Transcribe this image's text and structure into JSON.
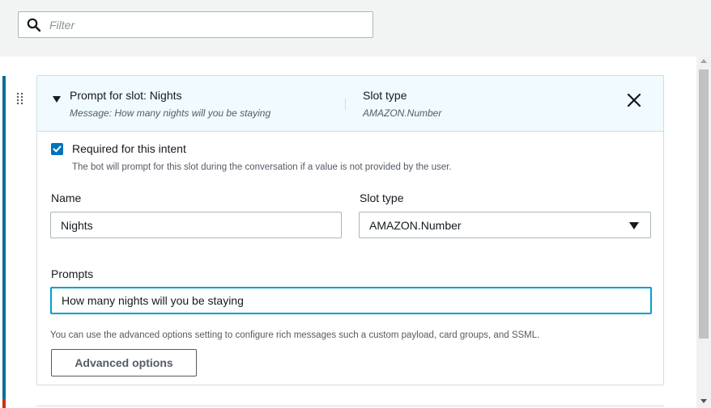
{
  "filter": {
    "placeholder": "Filter"
  },
  "slot_card": {
    "title": "Prompt for slot: Nights",
    "message": "Message: How many nights will you be staying",
    "slot_type_label": "Slot type",
    "slot_type_value": "AMAZON.Number",
    "required_label": "Required for this intent",
    "required_checked": true,
    "required_description": "The bot will prompt for this slot during the conversation if a value is not provided by the user.",
    "name_label": "Name",
    "name_value": "Nights",
    "slot_type_field_label": "Slot type",
    "slot_type_selected": "AMAZON.Number",
    "prompts_label": "Prompts",
    "prompt_value": "How many nights will you be staying",
    "advanced_description": "You can use the advanced options setting to configure rich messages such a custom payload, card groups, and SSML.",
    "advanced_button": "Advanced options"
  },
  "icons": {
    "search": "search-icon",
    "expand": "caret-down-icon",
    "close": "close-icon",
    "drag": "drag-handle-icon",
    "checkbox": "check-icon",
    "select": "dropdown-arrow-icon"
  },
  "colors": {
    "accent": "#0073bb",
    "focus_border": "#00a1c9",
    "header_bg": "#f1faff",
    "left_accent": "#0b6e99"
  }
}
